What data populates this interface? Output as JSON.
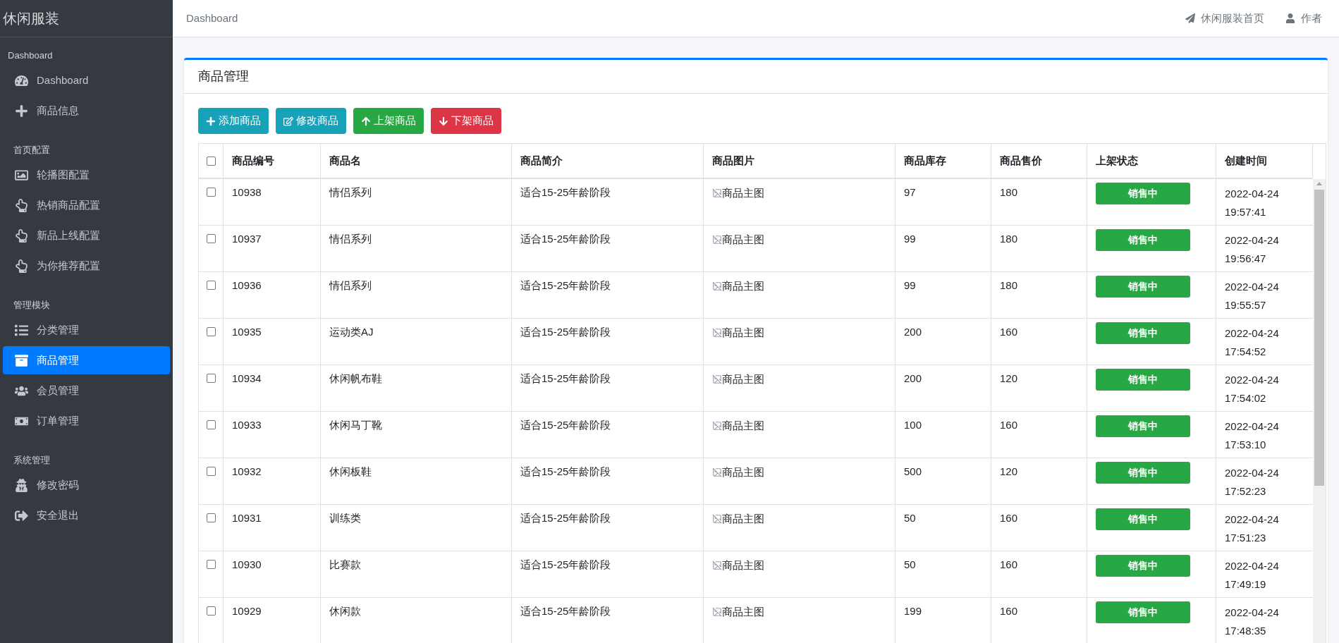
{
  "sidebar": {
    "brand": "休闲服装",
    "sections": [
      {
        "title": "Dashboard",
        "items": [
          {
            "label": "Dashboard",
            "selected": false
          },
          {
            "label": "商品信息",
            "selected": false
          }
        ]
      },
      {
        "title": "首页配置",
        "items": [
          {
            "label": "轮播图配置",
            "selected": false
          },
          {
            "label": "热销商品配置",
            "selected": false
          },
          {
            "label": "新品上线配置",
            "selected": false
          },
          {
            "label": "为你推荐配置",
            "selected": false
          }
        ]
      },
      {
        "title": "管理模块",
        "items": [
          {
            "label": "分类管理",
            "selected": false
          },
          {
            "label": "商品管理",
            "selected": true
          },
          {
            "label": "会员管理",
            "selected": false
          },
          {
            "label": "订单管理",
            "selected": false
          }
        ]
      },
      {
        "title": "系统管理",
        "items": [
          {
            "label": "修改密码",
            "selected": false
          },
          {
            "label": "安全退出",
            "selected": false
          }
        ]
      }
    ]
  },
  "topbar": {
    "breadcrumb": "Dashboard",
    "links": [
      "休闲服装首页",
      "作者"
    ]
  },
  "card": {
    "title": "商品管理",
    "buttons": [
      {
        "label": "添加商品",
        "kind": "info"
      },
      {
        "label": "修改商品",
        "kind": "info"
      },
      {
        "label": "上架商品",
        "kind": "success"
      },
      {
        "label": "下架商品",
        "kind": "danger"
      }
    ],
    "table": {
      "select_all_checked": false,
      "columns": [
        "商品编号",
        "商品名",
        "商品简介",
        "商品图片",
        "商品库存",
        "商品售价",
        "上架状态",
        "创建时间"
      ],
      "rows": [
        {
          "checked": false,
          "id": "10938",
          "name": "情侣系列",
          "intro": "适合15-25年龄阶段",
          "image_alt": "商品主图",
          "stock": "97",
          "price": "180",
          "status": "销售中",
          "created": "2022-04-24 19:57:41"
        },
        {
          "checked": false,
          "id": "10937",
          "name": "情侣系列",
          "intro": "适合15-25年龄阶段",
          "image_alt": "商品主图",
          "stock": "99",
          "price": "180",
          "status": "销售中",
          "created": "2022-04-24 19:56:47"
        },
        {
          "checked": false,
          "id": "10936",
          "name": "情侣系列",
          "intro": "适合15-25年龄阶段",
          "image_alt": "商品主图",
          "stock": "99",
          "price": "180",
          "status": "销售中",
          "created": "2022-04-24 19:55:57"
        },
        {
          "checked": false,
          "id": "10935",
          "name": "运动类AJ",
          "intro": "适合15-25年龄阶段",
          "image_alt": "商品主图",
          "stock": "200",
          "price": "160",
          "status": "销售中",
          "created": "2022-04-24 17:54:52"
        },
        {
          "checked": false,
          "id": "10934",
          "name": "休闲帆布鞋",
          "intro": "适合15-25年龄阶段",
          "image_alt": "商品主图",
          "stock": "200",
          "price": "120",
          "status": "销售中",
          "created": "2022-04-24 17:54:02"
        },
        {
          "checked": false,
          "id": "10933",
          "name": "休闲马丁靴",
          "intro": "适合15-25年龄阶段",
          "image_alt": "商品主图",
          "stock": "100",
          "price": "160",
          "status": "销售中",
          "created": "2022-04-24 17:53:10"
        },
        {
          "checked": false,
          "id": "10932",
          "name": "休闲板鞋",
          "intro": "适合15-25年龄阶段",
          "image_alt": "商品主图",
          "stock": "500",
          "price": "120",
          "status": "销售中",
          "created": "2022-04-24 17:52:23"
        },
        {
          "checked": false,
          "id": "10931",
          "name": "训练类",
          "intro": "适合15-25年龄阶段",
          "image_alt": "商品主图",
          "stock": "50",
          "price": "160",
          "status": "销售中",
          "created": "2022-04-24 17:51:23"
        },
        {
          "checked": false,
          "id": "10930",
          "name": "比赛款",
          "intro": "适合15-25年龄阶段",
          "image_alt": "商品主图",
          "stock": "50",
          "price": "160",
          "status": "销售中",
          "created": "2022-04-24 17:49:19"
        },
        {
          "checked": false,
          "id": "10929",
          "name": "休闲款",
          "intro": "适合15-25年龄阶段",
          "image_alt": "商品主图",
          "stock": "199",
          "price": "160",
          "status": "销售中",
          "created": "2022-04-24 17:48:35"
        }
      ]
    }
  }
}
